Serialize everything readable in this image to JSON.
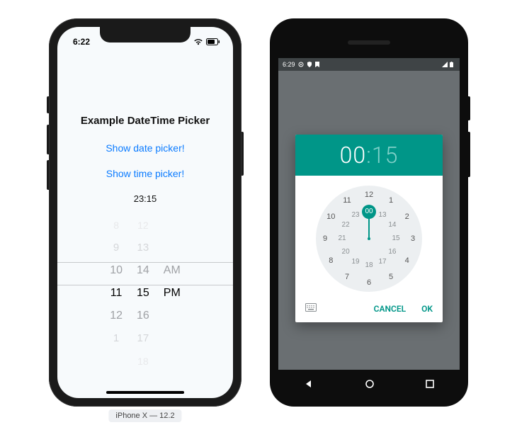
{
  "ios": {
    "status_time": "6:22",
    "title": "Example DateTime Picker",
    "show_date_label": "Show date picker!",
    "show_time_label": "Show time picker!",
    "value": "23:15",
    "picker": {
      "hours": [
        "8",
        "9",
        "10",
        "11",
        "12",
        "1"
      ],
      "minutes": [
        "12",
        "13",
        "14",
        "15",
        "16",
        "17",
        "18"
      ],
      "ampm": [
        "AM",
        "PM"
      ]
    },
    "selected_hour": "11",
    "selected_minute": "15",
    "selected_ampm": "PM",
    "caption": "iPhone X — 12.2"
  },
  "android": {
    "status_time": "6:29",
    "header_hour": "00",
    "header_sep": ":",
    "header_min": "15",
    "outer_hours": [
      "12",
      "1",
      "2",
      "3",
      "4",
      "5",
      "6",
      "7",
      "8",
      "9",
      "10",
      "11"
    ],
    "inner_hours": [
      "00",
      "13",
      "14",
      "15",
      "16",
      "17",
      "18",
      "19",
      "20",
      "21",
      "22",
      "23"
    ],
    "selected_inner_index": 0,
    "cancel_label": "CANCEL",
    "ok_label": "OK"
  }
}
